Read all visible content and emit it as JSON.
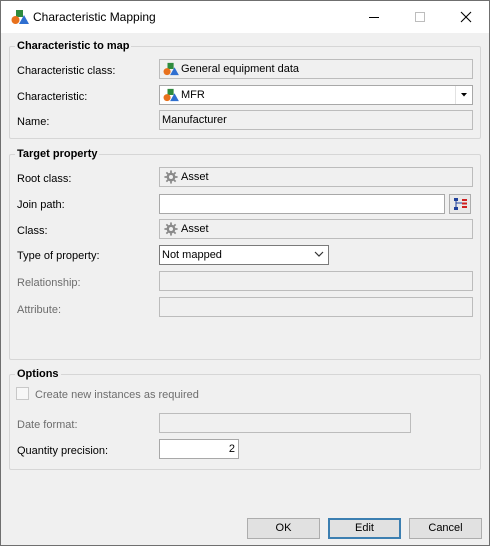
{
  "window": {
    "title": "Characteristic Mapping"
  },
  "characteristic_to_map": {
    "title": "Characteristic to map",
    "class_label": "Characteristic class:",
    "class_value": "General equipment data",
    "characteristic_label": "Characteristic:",
    "characteristic_value": "MFR",
    "name_label": "Name:",
    "name_value": "Manufacturer"
  },
  "target_property": {
    "title": "Target property",
    "root_class_label": "Root class:",
    "root_class_value": "Asset",
    "join_path_label": "Join path:",
    "join_path_value": "",
    "class_label": "Class:",
    "class_value": "Asset",
    "type_label": "Type of property:",
    "type_value": "Not mapped",
    "relationship_label": "Relationship:",
    "relationship_value": "",
    "attribute_label": "Attribute:",
    "attribute_value": ""
  },
  "options": {
    "title": "Options",
    "create_instances_label": "Create new instances as required",
    "date_format_label": "Date format:",
    "date_format_value": "",
    "quantity_precision_label": "Quantity precision:",
    "quantity_precision_value": "2"
  },
  "buttons": {
    "ok": "OK",
    "edit": "Edit",
    "cancel": "Cancel"
  },
  "icons": {
    "app": "shapes-icon",
    "characteristic_class": "shapes-icon",
    "characteristic": "shapes-icon",
    "root_class": "gear-icon",
    "class": "gear-icon",
    "join_path": "tree-browse-icon"
  },
  "colors": {
    "default_button_border": "#3c7fb1",
    "titlebar": "#ffffff",
    "background": "#f0f0f0"
  }
}
